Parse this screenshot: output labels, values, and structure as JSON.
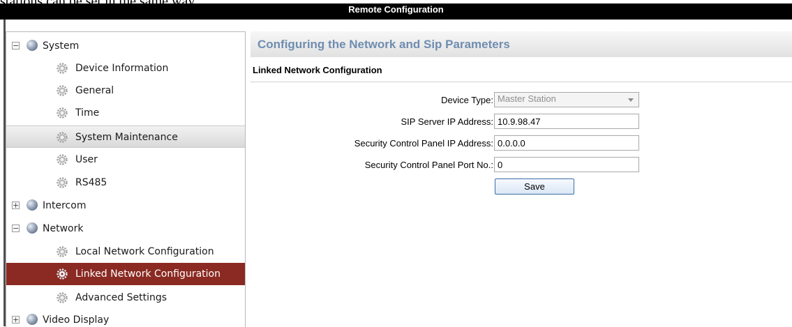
{
  "document": {
    "text_above": "stations can be set in the same way."
  },
  "window": {
    "title": "Remote Configuration"
  },
  "sidebar": {
    "items": [
      {
        "label": "System",
        "level": 0,
        "expander": "−",
        "icon": "globe-icon"
      },
      {
        "label": "Device Information",
        "level": 1,
        "icon": "gear-icon"
      },
      {
        "label": "General",
        "level": 1,
        "icon": "gear-icon"
      },
      {
        "label": "Time",
        "level": 1,
        "icon": "gear-icon"
      },
      {
        "label": "System Maintenance",
        "level": 1,
        "icon": "gear-icon",
        "state": "hover"
      },
      {
        "label": "User",
        "level": 1,
        "icon": "gear-icon"
      },
      {
        "label": "RS485",
        "level": 1,
        "icon": "gear-icon"
      },
      {
        "label": "Intercom",
        "level": 0,
        "expander": "+",
        "icon": "globe-icon"
      },
      {
        "label": "Network",
        "level": 0,
        "expander": "−",
        "icon": "globe-icon"
      },
      {
        "label": "Local Network Configuration",
        "level": 1,
        "icon": "gear-icon"
      },
      {
        "label": "Linked Network Configuration",
        "level": 1,
        "icon": "gear-icon",
        "state": "selected"
      },
      {
        "label": "Advanced Settings",
        "level": 1,
        "icon": "gear-icon"
      },
      {
        "label": "Video Display",
        "level": 0,
        "expander": "+",
        "icon": "globe-icon"
      }
    ]
  },
  "main": {
    "section_title": "Configuring the Network and Sip Parameters",
    "subsection_title": "Linked Network Configuration",
    "form": {
      "device_type_label": "Device Type:",
      "device_type_value": "Master Station",
      "sip_label": "SIP Server IP Address:",
      "sip_value": "10.9.98.47",
      "panel_ip_label": "Security Control Panel IP Address:",
      "panel_ip_value": "0.0.0.0",
      "panel_port_label": "Security Control Panel Port No.:",
      "panel_port_value": "0"
    },
    "save_label": "Save"
  },
  "colors": {
    "selected_row": "#8a2a22",
    "section_title": "#6f8db0",
    "title_bar": "#000000"
  }
}
